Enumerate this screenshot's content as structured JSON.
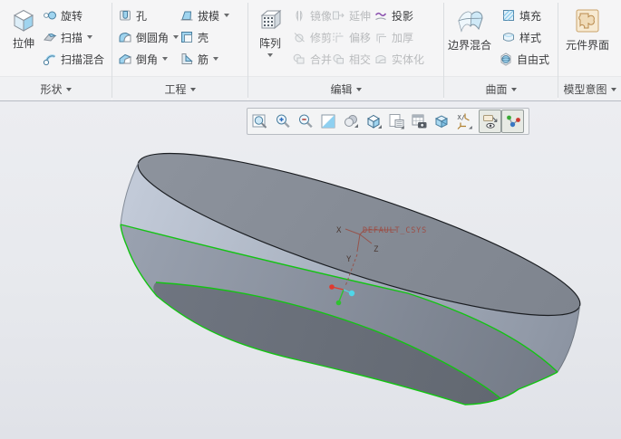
{
  "ribbon": {
    "groups": [
      {
        "label": "形状",
        "items": [
          {
            "label": "拉伸",
            "icon": "extrude-icon",
            "big": true
          },
          {
            "label": "旋转",
            "icon": "revolve-icon"
          },
          {
            "label": "扫描",
            "icon": "sweep-icon",
            "dropdown": true
          },
          {
            "label": "扫描混合",
            "icon": "swept-blend-icon"
          }
        ]
      },
      {
        "label": "工程",
        "items": [
          {
            "label": "孔",
            "icon": "hole-icon"
          },
          {
            "label": "倒圆角",
            "icon": "round-icon",
            "dropdown": true
          },
          {
            "label": "倒角",
            "icon": "chamfer-icon",
            "dropdown": true
          },
          {
            "label": "拔模",
            "icon": "draft-icon",
            "dropdown": true
          },
          {
            "label": "壳",
            "icon": "shell-icon"
          },
          {
            "label": "筋",
            "icon": "rib-icon",
            "dropdown": true
          }
        ]
      },
      {
        "label": "编辑",
        "items": [
          {
            "label": "阵列",
            "icon": "pattern-icon",
            "big": true,
            "dropdown": true
          },
          {
            "label": "镜像",
            "icon": "mirror-icon",
            "disabled": true
          },
          {
            "label": "修剪",
            "icon": "trim-icon",
            "disabled": true
          },
          {
            "label": "合并",
            "icon": "merge-icon",
            "disabled": true
          },
          {
            "label": "延伸",
            "icon": "extend-icon",
            "disabled": true
          },
          {
            "label": "偏移",
            "icon": "offset-icon",
            "disabled": true
          },
          {
            "label": "相交",
            "icon": "intersect-icon",
            "disabled": true
          },
          {
            "label": "投影",
            "icon": "project-icon",
            "disabled": false
          },
          {
            "label": "加厚",
            "icon": "thicken-icon",
            "disabled": true
          },
          {
            "label": "实体化",
            "icon": "solidify-icon",
            "disabled": true
          }
        ]
      },
      {
        "label": "曲面",
        "items": [
          {
            "label": "边界混合",
            "icon": "boundary-blend-icon",
            "big": true
          },
          {
            "label": "填充",
            "icon": "fill-icon"
          },
          {
            "label": "样式",
            "icon": "style-icon"
          },
          {
            "label": "自由式",
            "icon": "freestyle-icon"
          }
        ]
      },
      {
        "label": "模型意图",
        "items": [
          {
            "label": "元件界面",
            "icon": "component-interface-icon",
            "big": true
          }
        ]
      }
    ]
  },
  "graphics_toolbar": {
    "buttons": [
      {
        "icon": "box-zoom-icon",
        "pressed": false
      },
      {
        "icon": "zoom-in-icon",
        "pressed": false
      },
      {
        "icon": "zoom-out-icon",
        "pressed": false
      },
      {
        "icon": "repaint-icon",
        "pressed": false
      },
      {
        "icon": "display-style-icon",
        "pressed": false,
        "dropdown": true
      },
      {
        "icon": "saved-views-icon",
        "pressed": false,
        "dropdown": true
      },
      {
        "icon": "view-manager-icon",
        "pressed": false,
        "dropdown": true
      },
      {
        "icon": "image-capture-icon",
        "pressed": false
      },
      {
        "icon": "section-view-icon",
        "pressed": false
      },
      {
        "icon": "datum-display-icon",
        "pressed": false,
        "dropdown": true
      },
      {
        "icon": "annotation-display-icon",
        "pressed": true
      },
      {
        "icon": "spin-center-icon",
        "pressed": true
      }
    ]
  },
  "viewport": {
    "csys_label": "DEFAULT_CSYS",
    "axes": {
      "x": "X",
      "y": "Y",
      "z": "Z"
    },
    "colors": {
      "highlight_edge_green": "#14c314",
      "csys_maroon": "#9a4f46",
      "spin_center_red": "#e03a2f",
      "spin_center_cyan": "#4fd6e8",
      "spin_center_green": "#2ec22e",
      "model_top_gray": "#848a94",
      "model_side_light": "#b9c2d0",
      "model_side_dark": "#6b717c"
    }
  }
}
